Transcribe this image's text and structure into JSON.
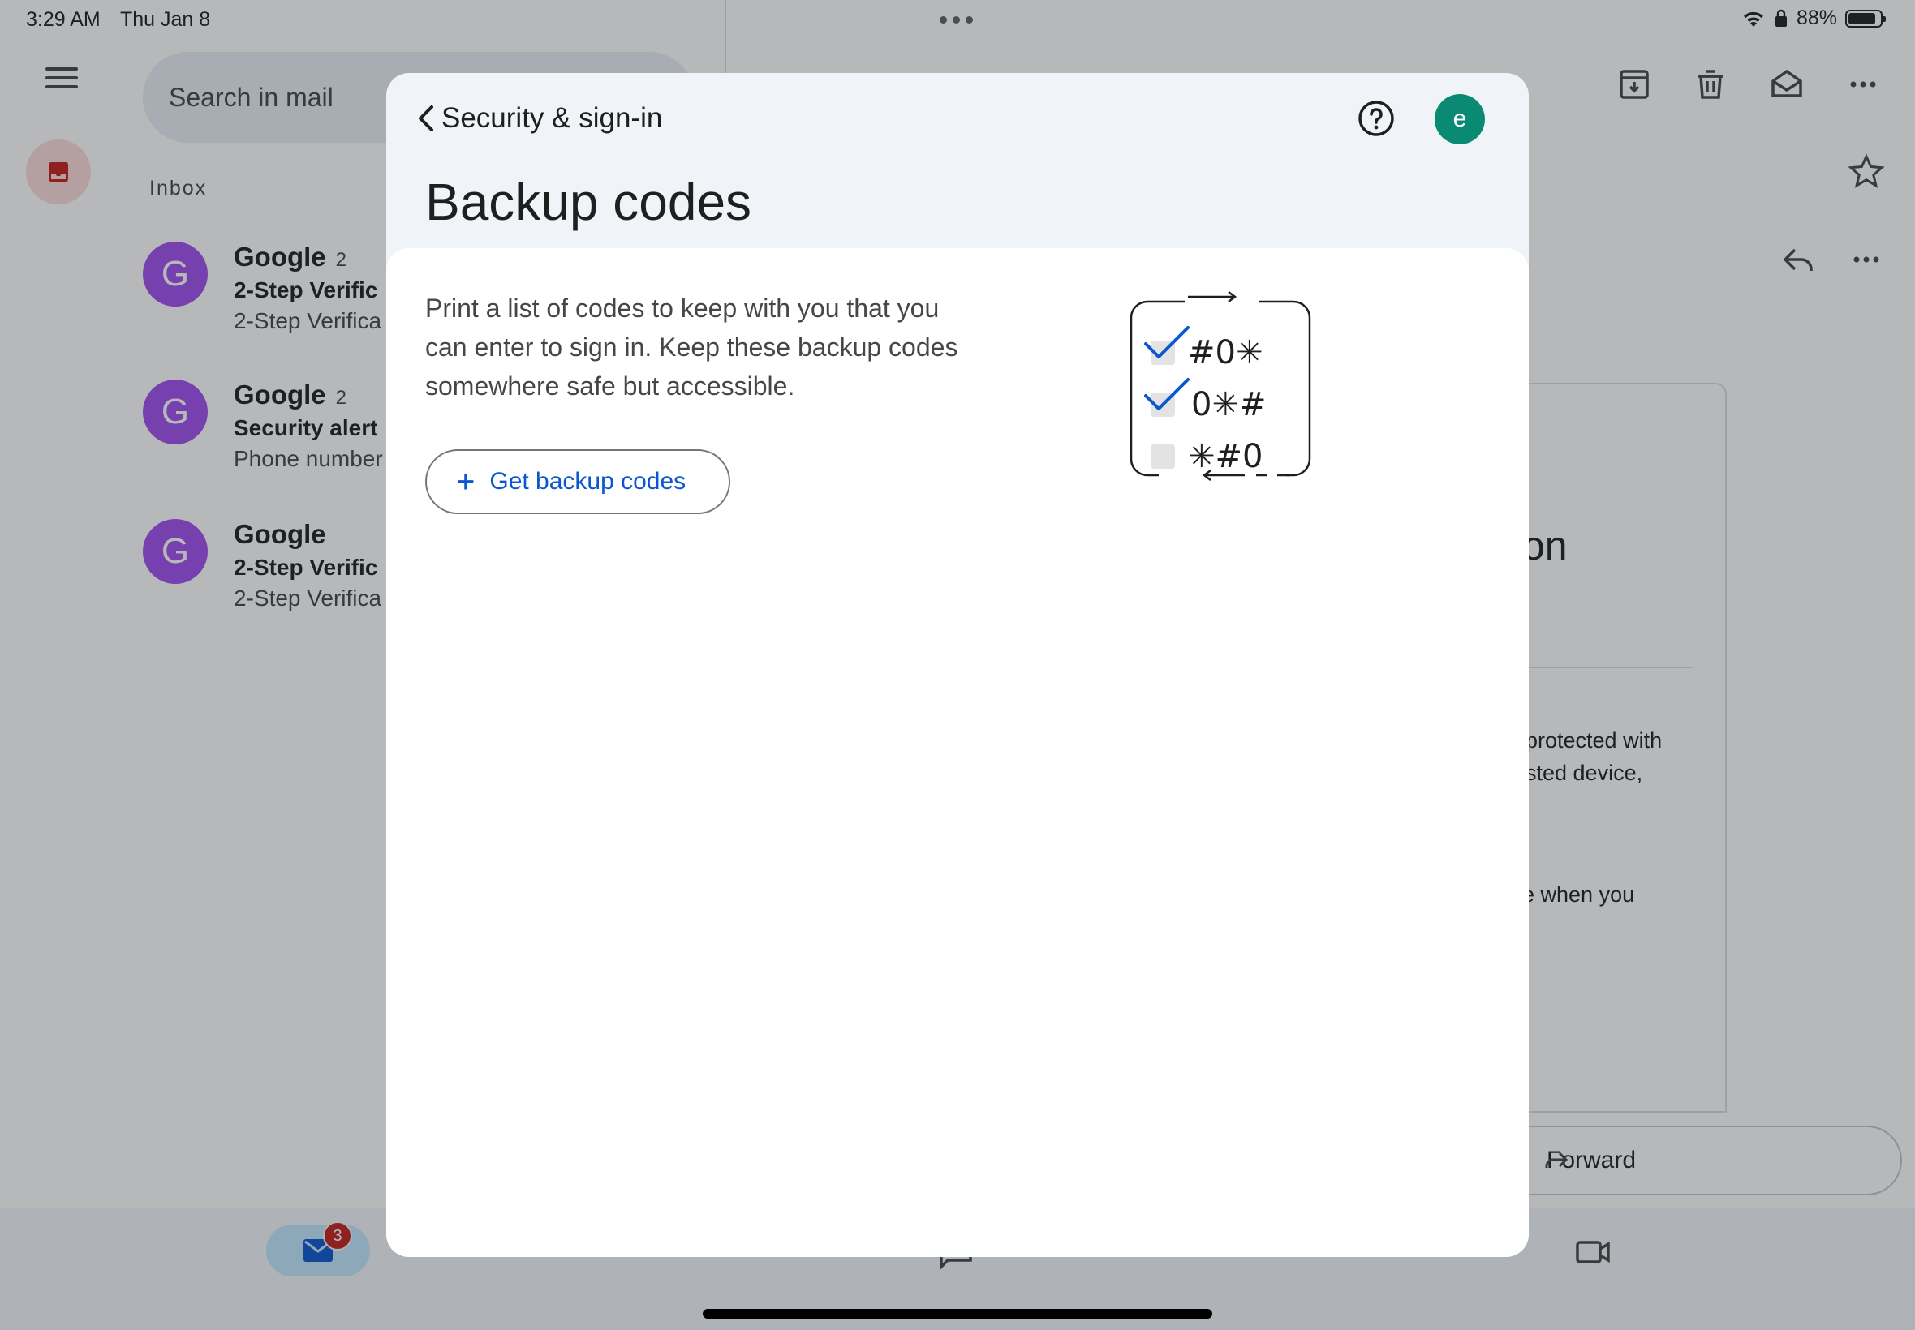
{
  "status_bar": {
    "time": "3:29 AM",
    "date": "Thu Jan 8",
    "battery": "88%"
  },
  "gmail": {
    "search_placeholder": "Search in mail",
    "inbox_label": "Inbox",
    "emails": [
      {
        "avatar": "G",
        "sender": "Google",
        "count": "2",
        "subject": "2-Step Verific",
        "snippet": "2-Step Verifica"
      },
      {
        "avatar": "G",
        "sender": "Google",
        "count": "2",
        "subject": "Security alert",
        "snippet": "Phone number"
      },
      {
        "avatar": "G",
        "sender": "Google",
        "count": "",
        "subject": "2-Step Verific",
        "snippet": "2-Step Verifica"
      }
    ],
    "reading_pane": {
      "heading_fragment": "on",
      "line1": "protected with",
      "line2": "sted device,",
      "line3": "e when you"
    },
    "forward_label": "Forward",
    "mail_badge": "3"
  },
  "sheet": {
    "header_title": "Security & sign-in",
    "account_initial": "e",
    "page_title": "Backup codes",
    "description": "Print a list of codes to keep with you that you can enter to sign in. Keep these backup codes somewhere safe but accessible.",
    "get_codes_label": "Get backup codes",
    "illustration_rows": [
      "#0✳",
      "0✳#",
      "✳#0"
    ]
  },
  "colors": {
    "accent": "#0b57d0",
    "avatar_purple": "#9f4ff0",
    "account_green": "#0b8a73",
    "badge_red": "#c5221f"
  }
}
